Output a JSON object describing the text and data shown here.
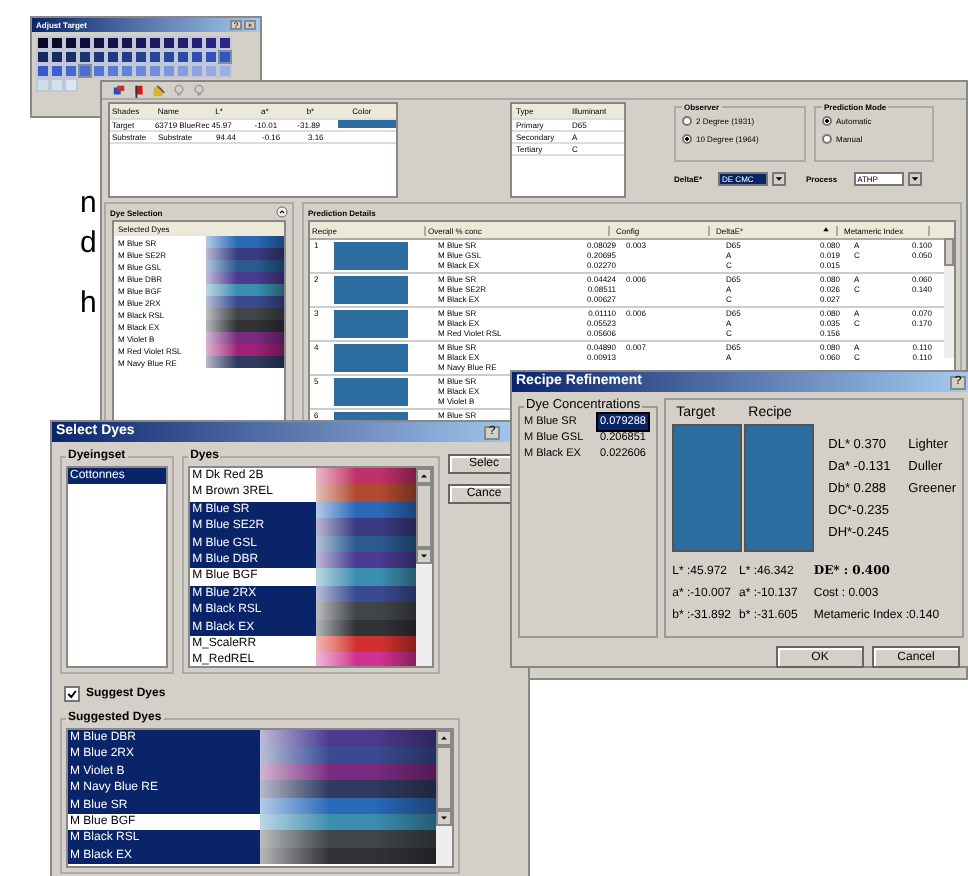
{
  "background_text": [
    "n",
    "d",
    "h"
  ],
  "adjust_target": {
    "title": "Adjust Target",
    "help": "?",
    "close": "×"
  },
  "main": {
    "shades_table": {
      "columns": [
        "Shades",
        "Name",
        "L*",
        "a*",
        "b*",
        "Color"
      ],
      "rows": [
        {
          "cells": [
            "Target",
            "63719 BlueRec",
            "45.97",
            "-10.01",
            "-31.89"
          ],
          "color": "#2e6da0"
        },
        {
          "cells": [
            "Substrate",
            "Substrate",
            "94.44",
            "-0.16",
            "3.16"
          ]
        }
      ]
    },
    "illuminant_table": {
      "columns": [
        "Type",
        "Illuminant"
      ],
      "rows": [
        [
          "Primary",
          "D65"
        ],
        [
          "Secondary",
          "A"
        ],
        [
          "Tertiary",
          "C"
        ]
      ]
    },
    "observer": {
      "title": "Observer",
      "options": [
        {
          "label": "2 Degree (1931)",
          "selected": false
        },
        {
          "label": "10 Degree (1964)",
          "selected": true
        }
      ]
    },
    "prediction_mode": {
      "title": "Prediction Mode",
      "options": [
        {
          "label": "Automatic",
          "selected": true
        },
        {
          "label": "Manual",
          "selected": false
        }
      ]
    },
    "delta_e": {
      "label": "DeltaE*",
      "value": "DE CMC"
    },
    "process": {
      "label": "Process",
      "value": "ATHP"
    },
    "dye_selection": {
      "title": "Dye Selection",
      "list_title": "Selected Dyes",
      "dyes": [
        {
          "name": "M Blue SR",
          "color": "#2a68b8"
        },
        {
          "name": "M Blue SE2R",
          "color": "#3a3a80"
        },
        {
          "name": "M Blue GSL",
          "color": "#2a5a90"
        },
        {
          "name": "M Blue DBR",
          "color": "#4a3a90"
        },
        {
          "name": "M Blue BGF",
          "color": "#3a8eb0"
        },
        {
          "name": "M Blue 2RX",
          "color": "#3a4a90"
        },
        {
          "name": "M Black RSL",
          "color": "#404548"
        },
        {
          "name": "M Black EX",
          "color": "#303236"
        },
        {
          "name": "M Violet B",
          "color": "#7a2a80"
        },
        {
          "name": "M Red Violet RSL",
          "color": "#a0207a"
        },
        {
          "name": "M Navy Blue RE",
          "color": "#303a60"
        }
      ]
    },
    "prediction": {
      "title": "Prediction Details",
      "columns": [
        "Recipe",
        "Overall % conc",
        "Config",
        "DeltaE*",
        "Metameric Index"
      ],
      "rows": [
        {
          "recipe": "1",
          "color": "#2e6da0",
          "dyes": [
            "M Blue SR",
            "M Blue GSL",
            "M Black EX"
          ],
          "conc": [
            "0.08029",
            "0.20695",
            "0.02270"
          ],
          "config": "0.003",
          "delta_e": [
            [
              "D65",
              "0.080"
            ],
            [
              "A",
              "0.019"
            ],
            [
              "C",
              "0.015"
            ]
          ],
          "metameric": [
            [
              "A",
              "0.100"
            ],
            [
              "C",
              "0.050"
            ]
          ]
        },
        {
          "recipe": "2",
          "color": "#2e6da0",
          "dyes": [
            "M Blue SR",
            "M Blue SE2R",
            "M Black EX"
          ],
          "conc": [
            "0.04424",
            "0.08511",
            "0.00627"
          ],
          "config": "0.006",
          "delta_e": [
            [
              "D65",
              "0.080"
            ],
            [
              "A",
              "0.026"
            ],
            [
              "C",
              "0.027"
            ]
          ],
          "metameric": [
            [
              "A",
              "0.060"
            ],
            [
              "C",
              "0.140"
            ]
          ]
        },
        {
          "recipe": "3",
          "color": "#2e6da0",
          "dyes": [
            "M Blue SR",
            "M Black EX",
            "M Red Violet RSL"
          ],
          "conc": [
            "0.01110",
            "0.05523",
            "0.05606"
          ],
          "config": "0.006",
          "delta_e": [
            [
              "D65",
              "0.080"
            ],
            [
              "A",
              "0.035"
            ],
            [
              "C",
              "0.156"
            ]
          ],
          "metameric": [
            [
              "A",
              "0.070"
            ],
            [
              "C",
              "0.170"
            ]
          ]
        },
        {
          "recipe": "4",
          "color": "#2e6da0",
          "dyes": [
            "M Blue SR",
            "M Black EX",
            "M Navy Blue RE"
          ],
          "conc": [
            "0.04890",
            "0.00913"
          ],
          "config": "0.007",
          "delta_e": [
            [
              "D65",
              "0.080"
            ],
            [
              "A",
              "0.060"
            ]
          ],
          "metameric": [
            [
              "A",
              "0.110"
            ],
            [
              "C",
              "0.110"
            ]
          ]
        },
        {
          "recipe": "5",
          "color": "#2e6da0",
          "dyes": [
            "M Blue SR",
            "M Black EX",
            "M Violet B"
          ]
        },
        {
          "recipe": "6",
          "color": "#2e6da0",
          "dyes": [
            "M Blue SR"
          ]
        }
      ]
    }
  },
  "select_dyes": {
    "title": "Select Dyes",
    "help": "?",
    "dyeingset": {
      "title": "Dyeingset",
      "items": [
        {
          "name": "Cottonnes",
          "selected": true
        }
      ]
    },
    "dyes": {
      "title": "Dyes",
      "items": [
        {
          "name": "M Dk Red 2B",
          "selected": false,
          "color": "#c0306a"
        },
        {
          "name": "M Brown 3REL",
          "selected": false,
          "color": "#b04a30"
        },
        {
          "name": "M Blue SR",
          "selected": true,
          "color": "#2a68b8"
        },
        {
          "name": "M Blue SE2R",
          "selected": true,
          "color": "#3a3a80"
        },
        {
          "name": "M Blue GSL",
          "selected": true,
          "color": "#2a5a90"
        },
        {
          "name": "M Blue DBR",
          "selected": true,
          "color": "#4a3a90"
        },
        {
          "name": "M Blue BGF",
          "selected": false,
          "color": "#3a8eb0"
        },
        {
          "name": "M Blue 2RX",
          "selected": true,
          "color": "#3a4a90"
        },
        {
          "name": "M Black RSL",
          "selected": true,
          "color": "#404548"
        },
        {
          "name": "M Black EX",
          "selected": true,
          "color": "#303236"
        },
        {
          "name": "M_ScaleRR",
          "selected": false,
          "color": "#d03030"
        },
        {
          "name": "M_RedREL",
          "selected": false,
          "color": "#d03090"
        }
      ]
    },
    "buttons": [
      "Selec",
      "Cance"
    ],
    "suggest": {
      "label": "Suggest Dyes",
      "checked": true
    },
    "suggested": {
      "title": "Suggested Dyes",
      "items": [
        {
          "name": "M Blue DBR",
          "selected": true,
          "color": "#4a3a90"
        },
        {
          "name": "M Blue 2RX",
          "selected": true,
          "color": "#3a4a90"
        },
        {
          "name": "M Violet B",
          "selected": true,
          "color": "#7a2a80"
        },
        {
          "name": "M Navy Blue RE",
          "selected": true,
          "color": "#303a60"
        },
        {
          "name": "M Blue SR",
          "selected": true,
          "color": "#2a68b8"
        },
        {
          "name": "M Blue BGF",
          "selected": false,
          "color": "#3a8eb0"
        },
        {
          "name": "M Black RSL",
          "selected": true,
          "color": "#404548"
        },
        {
          "name": "M Black EX",
          "selected": true,
          "color": "#303236"
        }
      ]
    }
  },
  "recipe_refinement": {
    "title": "Recipe Refinement",
    "help": "?",
    "conc_title": "Dye Concentrations",
    "concs": [
      {
        "name": "M Blue SR",
        "value": "0.079288",
        "selected": true
      },
      {
        "name": "M Blue GSL",
        "value": "0.206851",
        "selected": false
      },
      {
        "name": "M Black EX",
        "value": "0.022606",
        "selected": false
      }
    ],
    "swatches": [
      {
        "label": "Target",
        "color": "#2e6da0"
      },
      {
        "label": "Recipe",
        "color": "#2e6da0"
      }
    ],
    "diffs": [
      {
        "value": "DL* 0.370",
        "note": "Lighter"
      },
      {
        "value": "Da* -0.131",
        "note": "Duller"
      },
      {
        "value": "Db* 0.288",
        "note": "Greener"
      },
      {
        "value": "DC*-0.235"
      },
      {
        "value": "DH*-0.245"
      }
    ],
    "target_values": [
      "L* :45.972",
      "a* :-10.007",
      "b* :-31.892"
    ],
    "recipe_values": [
      "L* :46.342",
      "a* :-10.137",
      "b* :-31.605"
    ],
    "summary": [
      {
        "text": "DE* : 0.400",
        "emphasis": true
      },
      {
        "text": "Cost : 0.003",
        "emphasis": false
      },
      {
        "text": "Metameric Index :0.140",
        "emphasis": false
      }
    ],
    "buttons": [
      "OK",
      "Cancel"
    ]
  }
}
